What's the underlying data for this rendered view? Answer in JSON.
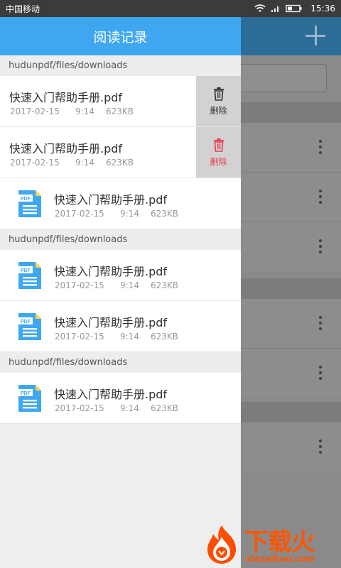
{
  "status_bar": {
    "carrier": "中国移动",
    "time": "15:36"
  },
  "drawer": {
    "title": "阅读记录",
    "delete_label": "删除",
    "groups": [
      {
        "path": "hudunpdf/files/downloads",
        "items": [
          {
            "name": "快速入门帮助手册.pdf",
            "date": "2017-02-15",
            "time": "9:14",
            "size": "623KB"
          },
          {
            "name": "快速入门帮助手册.pdf",
            "date": "2017-02-15",
            "time": "9:14",
            "size": "623KB"
          },
          {
            "name": "快速入门帮助手册.pdf",
            "date": "2017-02-15",
            "time": "9:14",
            "size": "623KB"
          }
        ]
      },
      {
        "path": "hudunpdf/files/downloads",
        "items": [
          {
            "name": "快速入门帮助手册.pdf",
            "date": "2017-02-15",
            "time": "9:14",
            "size": "623KB"
          },
          {
            "name": "快速入门帮助手册.pdf",
            "date": "2017-02-15",
            "time": "9:14",
            "size": "623KB"
          }
        ]
      },
      {
        "path": "hudunpdf/files/downloads",
        "items": [
          {
            "name": "快速入门帮助手册.pdf",
            "date": "2017-02-15",
            "time": "9:14",
            "size": "623KB"
          }
        ]
      }
    ]
  },
  "icons": {
    "pdf": "pdf-file-icon",
    "delete": "trash-icon",
    "add": "plus-icon",
    "more": "more-vertical-icon"
  },
  "colors": {
    "drawer_header": "#3fa7f2",
    "delete_active": "#e83c4c",
    "pdf_icon": "#3fa7f2"
  },
  "watermark": {
    "title": "下载火",
    "subtitle": "xiazaihuo.com"
  }
}
